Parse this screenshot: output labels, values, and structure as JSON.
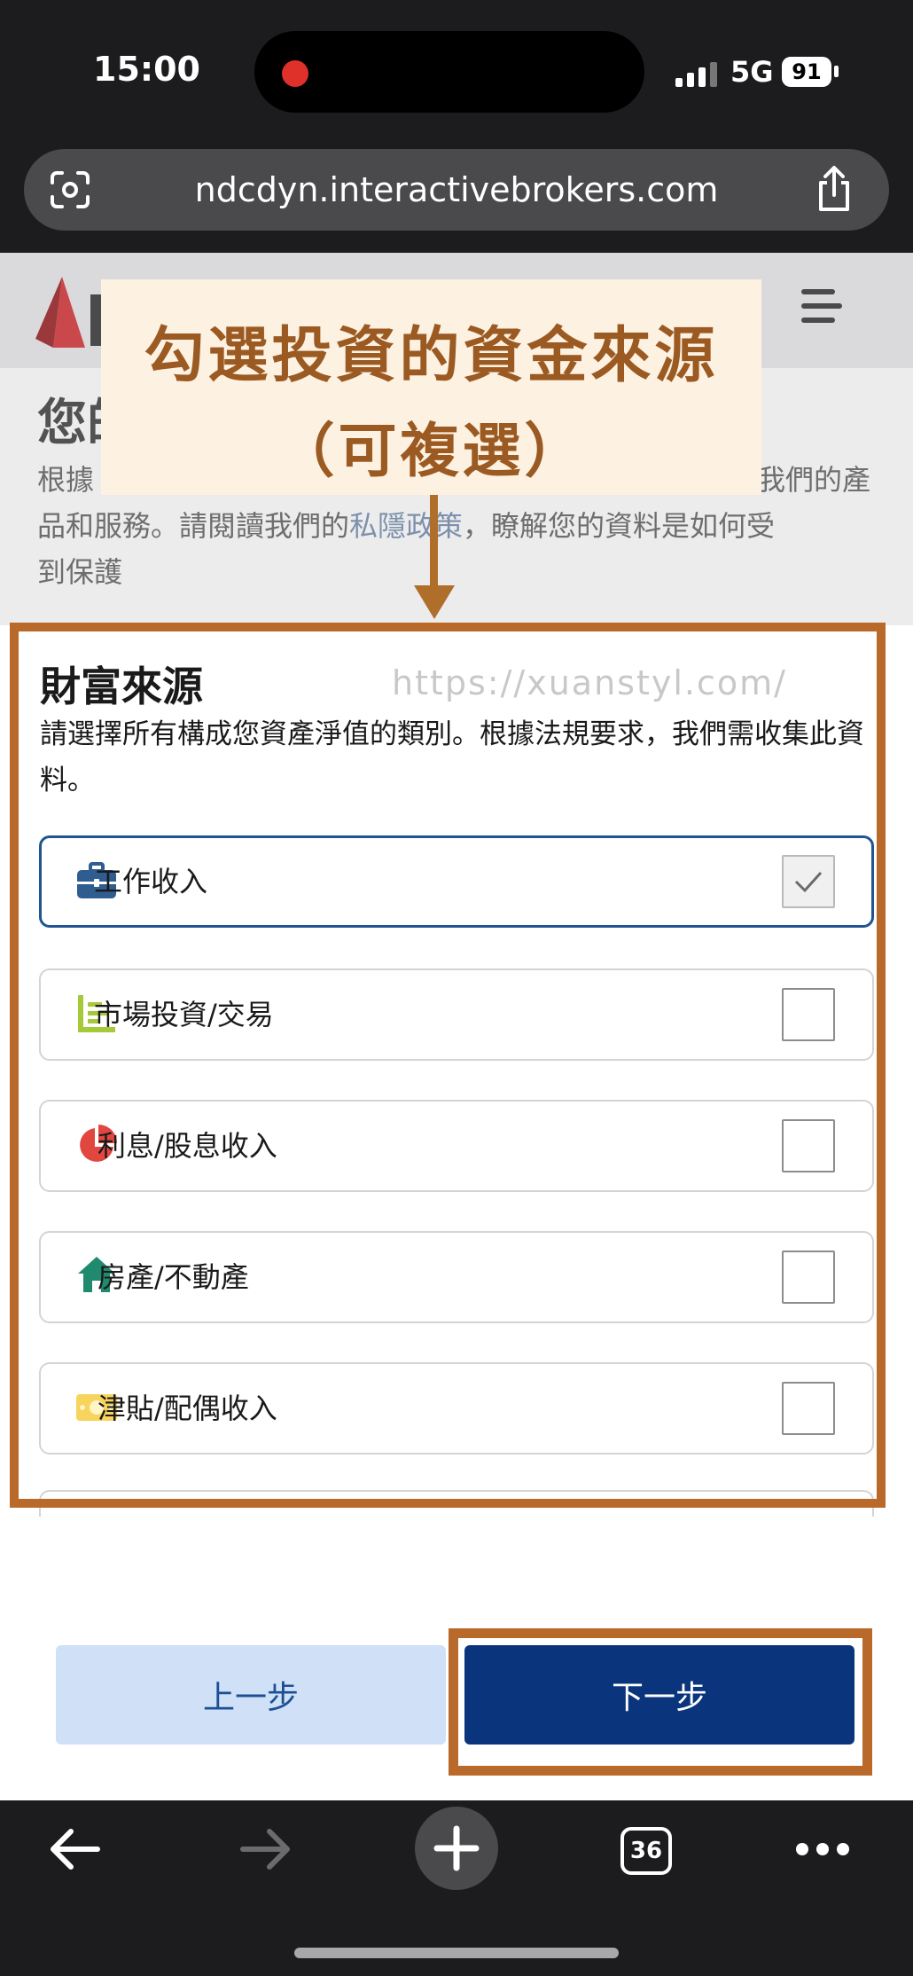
{
  "status_bar": {
    "time": "15:00",
    "network": "5G",
    "battery": "91"
  },
  "browser": {
    "url": "ndcdyn.interactivebrokers.com",
    "tab_count": "36"
  },
  "background_page": {
    "title": "您的",
    "text_before_link": "根據",
    "text_right_fragment": "我們的產",
    "text_line2_start": "品和服務。請閱讀我們的",
    "link_text": "私隱政策",
    "text_line2_end": "，瞭解您的資料是如何受",
    "text_line3": "到保護"
  },
  "annotation": {
    "line1": "勾選投資的資金來源",
    "line2": "（可複選）"
  },
  "watermark": "https://xuanstyl.com/",
  "section": {
    "title": "財富來源",
    "description": "請選擇所有構成您資產淨值的類別。根據法規要求，我們需收集此資料。",
    "options": [
      {
        "label": "工作收入",
        "icon": "briefcase-icon",
        "checked": true,
        "icon_color": "#2f5d8f"
      },
      {
        "label": "市場投資/交易",
        "icon": "bar-chart-icon",
        "checked": false,
        "icon_color": "#a6c93a"
      },
      {
        "label": "利息/股息收入",
        "icon": "pie-chart-icon",
        "checked": false,
        "icon_color": "#e2473f"
      },
      {
        "label": "房產/不動產",
        "icon": "house-icon",
        "checked": false,
        "icon_color": "#1f8a6e"
      },
      {
        "label": "津貼/配偶收入",
        "icon": "cash-icon",
        "checked": false,
        "icon_color": "#f7d45c"
      }
    ]
  },
  "buttons": {
    "prev": "上一步",
    "next": "下一步"
  },
  "colors": {
    "accent": "#0a357d",
    "annotation": "#b96a2b"
  }
}
